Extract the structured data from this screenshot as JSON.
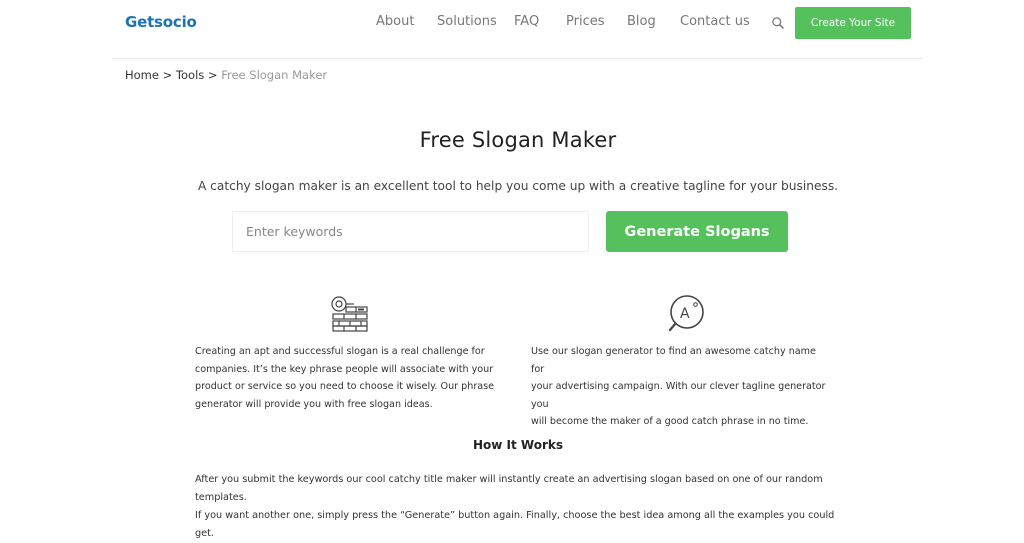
{
  "header": {
    "logo": "Getsocio",
    "nav": [
      "About",
      "Solutions",
      "FAQ",
      "Prices",
      "Blog",
      "Contact us"
    ],
    "search_icon": "search-icon",
    "cta_label": "Create Your Site"
  },
  "breadcrumb": {
    "items": [
      "Home",
      "Tools"
    ],
    "separator": ">",
    "current": "Free Slogan Maker"
  },
  "main": {
    "title": "Free Slogan Maker",
    "subtitle": "A catchy slogan maker is an excellent tool to help you come up with a creative tagline for your business.",
    "input_placeholder": "Enter keywords",
    "input_value": "",
    "generate_label": "Generate Slogans"
  },
  "features": [
    {
      "icon": "key-brick-icon",
      "lines": [
        "Creating an apt and successful slogan is a real challenge for",
        "companies. It’s the key phrase people will associate with your",
        "product or service so you need to choose it wisely. Our phrase",
        "generator will provide you with free slogan ideas."
      ]
    },
    {
      "icon": "magnifier-text-icon",
      "icon_text": "A",
      "lines": [
        "Use our slogan generator to find an awesome catchy name for",
        "your advertising campaign. With our clever tagline generator you",
        "will become the maker of a good catch phrase in no time."
      ]
    }
  ],
  "how": {
    "title": "How It Works",
    "lines": [
      "After you submit the keywords our cool catchy title maker will instantly create an advertising slogan based on one of our random templates.",
      "If you want another one, simply press the “Generate” button again. Finally, choose the best idea among all the examples you could get."
    ]
  },
  "colors": {
    "accent": "#55c15d",
    "logo": "#1a73b5",
    "nav_text": "#777777",
    "breadcrumb_current": "#999999"
  }
}
